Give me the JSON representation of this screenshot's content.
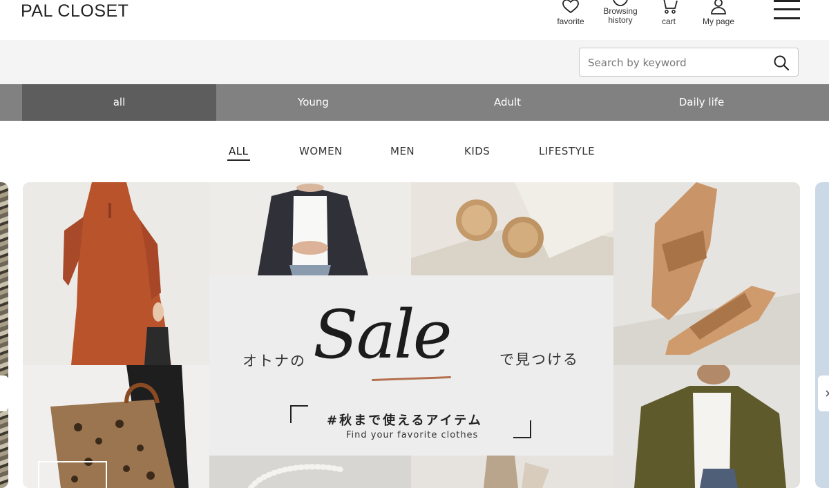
{
  "header": {
    "logo": "PAL CLOSET",
    "favorite_label": "favorite",
    "history_label_line1": "Browsing",
    "history_label_line2": "history",
    "cart_label": "cart",
    "mypage_label": "My page",
    "icons": [
      "heart-icon",
      "clock-icon",
      "cart-icon",
      "user-icon",
      "hamburger-menu-icon"
    ]
  },
  "search": {
    "placeholder": "Search by keyword",
    "value": ""
  },
  "categories": {
    "items": [
      {
        "label": "all",
        "active": true
      },
      {
        "label": "Young",
        "active": false
      },
      {
        "label": "Adult",
        "active": false
      },
      {
        "label": "Daily life",
        "active": false
      }
    ]
  },
  "subnav": {
    "items": [
      {
        "label": "ALL",
        "active": true
      },
      {
        "label": "WOMEN",
        "active": false
      },
      {
        "label": "MEN",
        "active": false
      },
      {
        "label": "KIDS",
        "active": false
      },
      {
        "label": "LIFESTYLE",
        "active": false
      }
    ]
  },
  "banner": {
    "text_left": "オトナの",
    "sale_word": "Sale",
    "text_right": "で見つける",
    "hashtag": "#秋まで使えるアイテム",
    "subline": "Find your favorite clothes",
    "accent_color": "#b4704e"
  },
  "colors": {
    "category_band": "#818181",
    "category_active": "#5d5d5d",
    "search_band": "#f4f4f4"
  }
}
